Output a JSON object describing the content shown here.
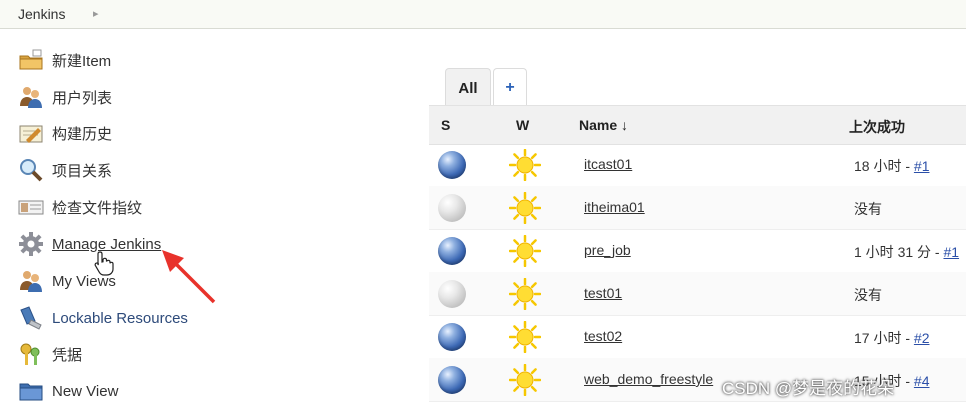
{
  "breadcrumb": {
    "root": "Jenkins"
  },
  "sidebar": {
    "items": [
      {
        "label": "新建Item",
        "icon": "new-item-folder-icon"
      },
      {
        "label": "用户列表",
        "icon": "users-icon"
      },
      {
        "label": "构建历史",
        "icon": "build-history-notepad-icon"
      },
      {
        "label": "项目关系",
        "icon": "search-magnifier-icon"
      },
      {
        "label": "检查文件指纹",
        "icon": "fingerprint-card-icon"
      },
      {
        "label": "Manage Jenkins",
        "icon": "gear-icon"
      },
      {
        "label": "My Views",
        "icon": "users-icon"
      },
      {
        "label": "Lockable Resources",
        "icon": "usb-key-icon"
      },
      {
        "label": "凭据",
        "icon": "credentials-keys-icon"
      },
      {
        "label": "New View",
        "icon": "folder-icon"
      }
    ]
  },
  "tabs": {
    "all": "All",
    "add": "+"
  },
  "table": {
    "headers": {
      "status": "S",
      "weather": "W",
      "name": "Name",
      "sort_arrow": "↓",
      "last_success": "上次成功"
    },
    "rows": [
      {
        "status": "blue",
        "weather": "sunny",
        "name": "itcast01",
        "last_success_text": "18 小时 - ",
        "last_success_build": "#1"
      },
      {
        "status": "grey",
        "weather": "sunny",
        "name": "itheima01",
        "last_success_text": "没有",
        "last_success_build": ""
      },
      {
        "status": "blue",
        "weather": "sunny",
        "name": "pre_job",
        "last_success_text": "1 小时 31 分 - ",
        "last_success_build": "#1"
      },
      {
        "status": "grey",
        "weather": "sunny",
        "name": "test01",
        "last_success_text": "没有",
        "last_success_build": ""
      },
      {
        "status": "blue",
        "weather": "sunny",
        "name": "test02",
        "last_success_text": "17 小时 - ",
        "last_success_build": "#2"
      },
      {
        "status": "blue",
        "weather": "sunny",
        "name": "web_demo_freestyle",
        "last_success_text": "15 小时 - ",
        "last_success_build": "#4"
      }
    ]
  },
  "watermark": "CSDN @梦是夜的花朵",
  "colors": {
    "annotation_arrow": "#e8322b",
    "link_blue": "#2b4fa8",
    "status_blue": "#3d69b5",
    "sun_yellow": "#f6c700"
  }
}
